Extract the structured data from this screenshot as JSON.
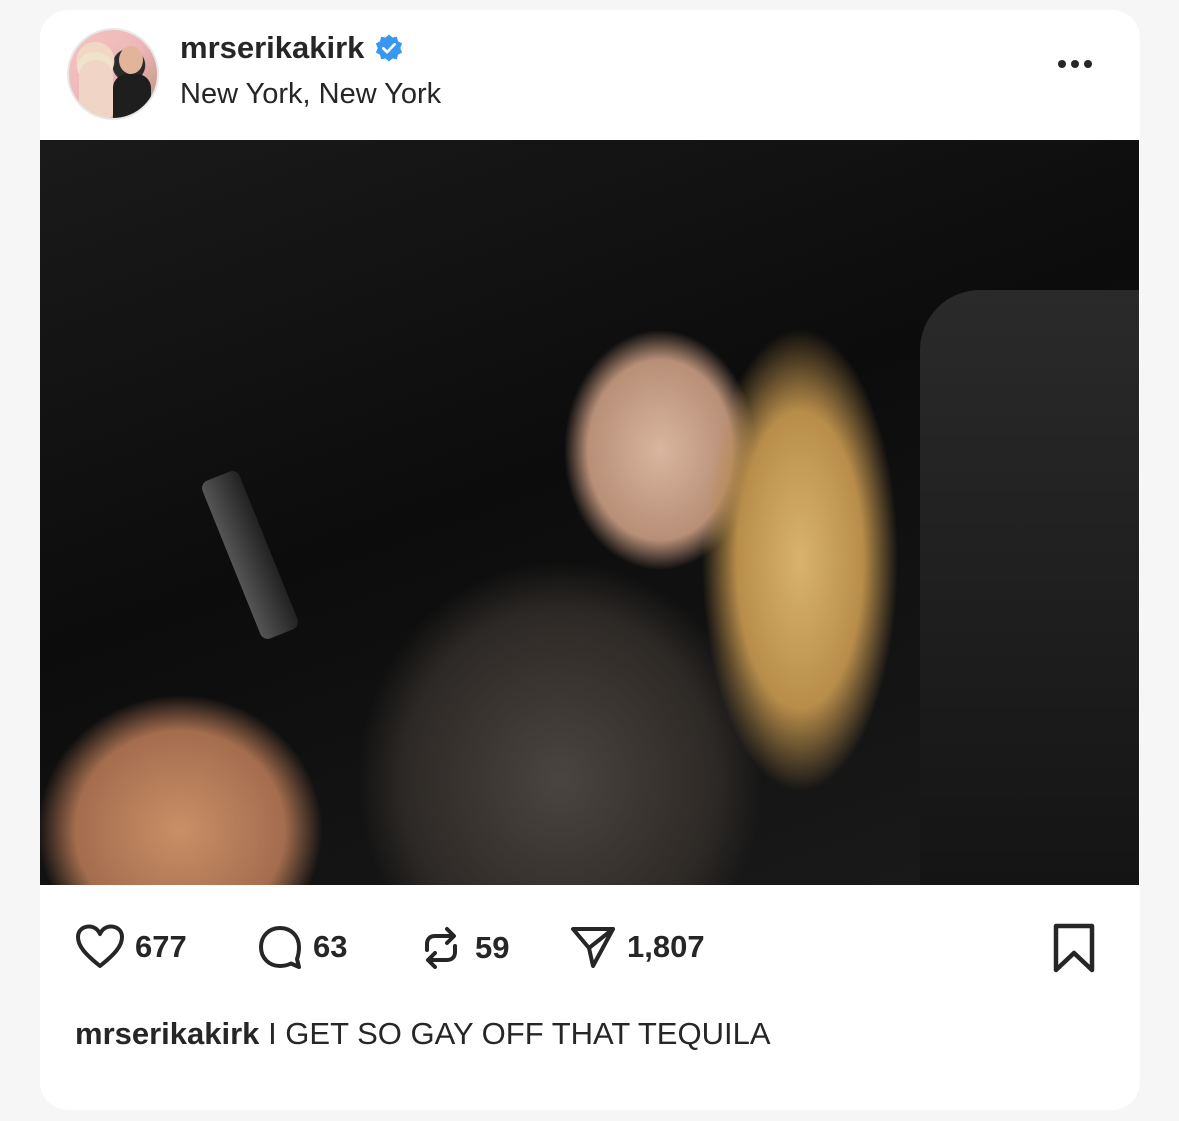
{
  "post": {
    "username": "mrserikakirk",
    "verified": true,
    "location": "New York, New York",
    "caption_user": "mrserikakirk",
    "caption_text": "I GET SO GAY OFF THAT TEQUILA"
  },
  "actions": {
    "likes": "677",
    "comments": "63",
    "reposts": "59",
    "shares": "1,807"
  },
  "icons": {
    "more": "more-options-icon",
    "like": "heart-icon",
    "comment": "comment-icon",
    "repost": "repost-icon",
    "share": "send-icon",
    "save": "bookmark-icon",
    "verified": "verified-badge-icon"
  },
  "colors": {
    "verified_badge": "#3897f0",
    "text": "#262626",
    "card": "#ffffff",
    "background": "#f6f6f6"
  }
}
